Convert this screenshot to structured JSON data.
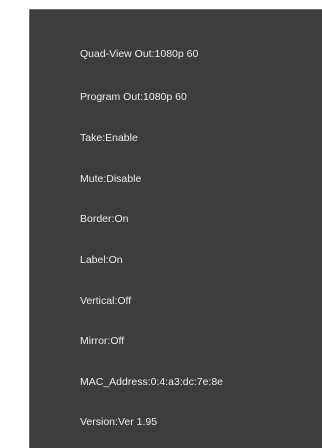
{
  "info": [
    {
      "key": "Quad-View Out",
      "value": "1080p 60"
    },
    {
      "key": "Program Out",
      "value": "1080p 60"
    },
    {
      "key": "Take",
      "value": "Enable"
    },
    {
      "key": "Mute",
      "value": "Disable"
    },
    {
      "key": "Border",
      "value": "On"
    },
    {
      "key": "Label",
      "value": "On"
    },
    {
      "key": "Vertical",
      "value": "Off"
    },
    {
      "key": "Mirror",
      "value": "Off"
    },
    {
      "key": "MAC_Address",
      "value": "0:4:a3:dc:7e:8e"
    },
    {
      "key": "Version",
      "value": "Ver 1.95"
    }
  ]
}
